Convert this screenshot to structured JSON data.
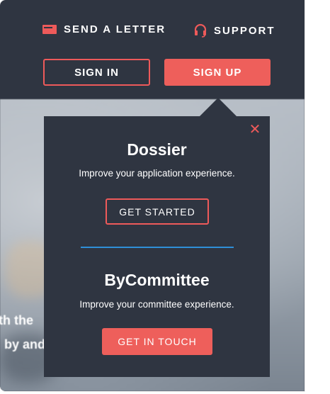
{
  "nav": {
    "send_letter": "SEND A LETTER",
    "support": "SUPPORT",
    "send_letter_icon": "envelope-icon",
    "support_icon": "headset-icon"
  },
  "auth": {
    "sign_in": "SIGN IN",
    "sign_up": "SIGN UP"
  },
  "hero": {
    "line1": "th the",
    "line2": "by and"
  },
  "popup": {
    "close_icon": "close-icon",
    "products": [
      {
        "title": "Dossier",
        "description": "Improve your application experience.",
        "cta": "GET STARTED"
      },
      {
        "title": "ByCommittee",
        "description": "Improve your committee experience.",
        "cta": "GET IN TOUCH"
      }
    ]
  },
  "colors": {
    "background": "#2f3541",
    "accent": "#ee5f5b",
    "divider": "#2f8fd8"
  }
}
